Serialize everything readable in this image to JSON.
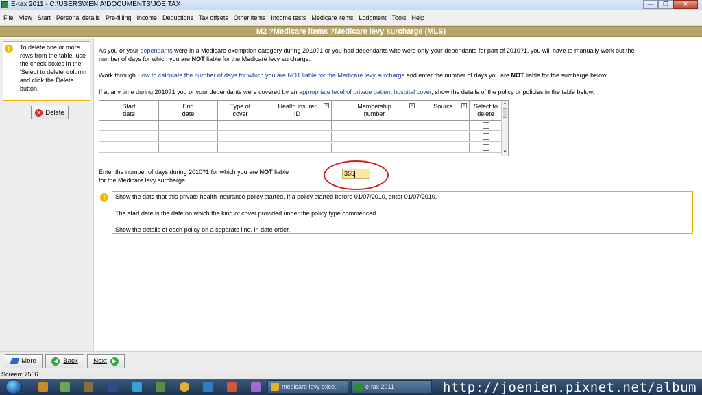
{
  "window": {
    "title": "E-tax 2011 - C:\\USERS\\XENIA\\DOCUMENTS\\JOE.TAX",
    "buttons": {
      "minimize": "—",
      "maximize": "❐",
      "close": "✕"
    }
  },
  "menu": {
    "items": [
      "File",
      "View",
      "Start",
      "Personal details",
      "Pre-filling",
      "Income",
      "Deductions",
      "Tax offsets",
      "Other items",
      "Income tests",
      "Medicare items",
      "Lodgment",
      "Tools",
      "Help"
    ]
  },
  "header": {
    "title": "M2 ?Medicare items ?Medicare levy surcharge (MLS)"
  },
  "left": {
    "tip": "To delete one or more rows from the table, use the check boxes in the 'Select to delete' column and click the Delete button.",
    "delete_label": "Delete"
  },
  "main": {
    "p1_pre": "As you or your ",
    "p1_link": "dependants",
    "p1_post": " were in a Medicare exemption category during 2010?1 or you had dependants who were only your dependants for part of 2010?1, you will have to manually work out the",
    "p1_line2_pre": "number of days for which you are ",
    "p1_line2_bold": "NOT",
    "p1_line2_post": " liable for the Medicare levy surcharge.",
    "p2_pre": "Work through ",
    "p2_link": "How to calculate the number of days for which you are NOT liable for the Medicare levy surcharge",
    "p2_mid": " and enter the number of days you are ",
    "p2_bold": "NOT",
    "p2_post": " liable for the surcharge below.",
    "p3_pre": "If at any time during 2010?1 you or your dependants were covered by an ",
    "p3_link": "appropriate level of private patient hospital cover",
    "p3_post": ", show the details of the policy or policies in the table below."
  },
  "table": {
    "headers": [
      {
        "line1": "Start",
        "line2": "date"
      },
      {
        "line1": "End",
        "line2": "date"
      },
      {
        "line1": "Type of",
        "line2": "cover"
      },
      {
        "line1": "Health insurer",
        "line2": "ID"
      },
      {
        "line1": "Membership",
        "line2": "number"
      },
      {
        "line1": "Source",
        "line2": ""
      },
      {
        "line1": "Select to",
        "line2": "delete"
      }
    ]
  },
  "days": {
    "label_pre": "Enter the number of days during 2010?1 for which you are ",
    "label_bold": "NOT",
    "label_post": " liable",
    "label_line2": "for the Medicare levy surcharge",
    "value": "365"
  },
  "info": {
    "line1": "Show the date that this private health insurance policy started. If a policy started before 01/07/2010, enter 01/07/2010.",
    "line2": "The start date is the date on which the kind of cover provided under the policy type commenced.",
    "line3": "Show the details of each policy on a separate line, in date order."
  },
  "nav": {
    "more": "More",
    "back": "Back",
    "next": "Next"
  },
  "status": {
    "text": "Screen: 7506"
  },
  "taskbar": {
    "task1": "medicare levy exce...",
    "task2": "e-tax 2011 -"
  },
  "watermark": "http://joenien.pixnet.net/album",
  "colors": {
    "header": "#b5a56a",
    "link": "#1a3b9e",
    "tip_border": "#e9b400",
    "input_bg": "#fbe7a3",
    "annotation": "#d42020"
  }
}
